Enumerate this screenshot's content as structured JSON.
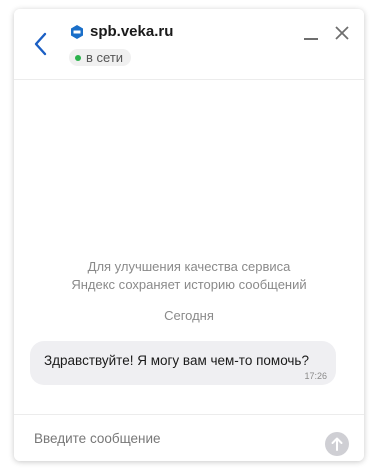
{
  "header": {
    "title": "spb.veka.ru",
    "status": "в сети",
    "logo_icon": "veka-logo-icon",
    "status_color": "#2bb24c",
    "accent_color": "#1b5fc4"
  },
  "chat": {
    "notice_line1": "Для улучшения качества сервиса",
    "notice_line2": "Яндекс сохраняет историю сообщений",
    "date_separator": "Сегодня",
    "messages": [
      {
        "text": "Здравствуйте! Я могу вам чем-то помочь?",
        "time": "17:26"
      }
    ]
  },
  "composer": {
    "placeholder": "Введите сообщение",
    "value": ""
  }
}
